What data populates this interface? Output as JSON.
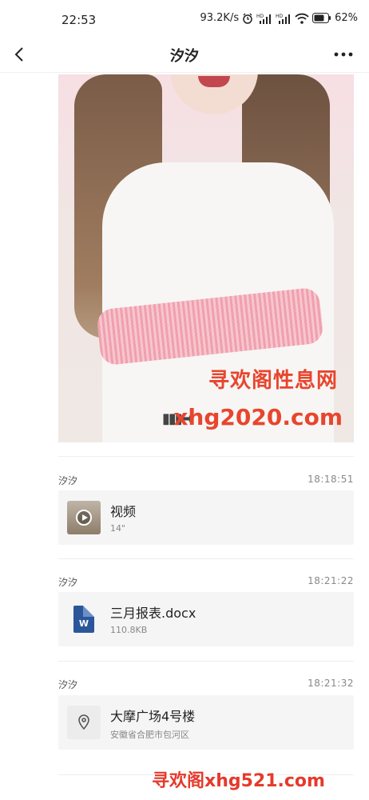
{
  "status_bar": {
    "time": "22:53",
    "speed": "93.2K/s",
    "battery": "62%"
  },
  "header": {
    "title": "汐汐"
  },
  "photo": {
    "watermark_cn": "寻欢阁性息网",
    "watermark_url": "xhg2020.com"
  },
  "messages": [
    {
      "sender": "汐汐",
      "time": "18:18:51",
      "title": "视频",
      "subtitle": "14\"",
      "type": "video"
    },
    {
      "sender": "汐汐",
      "time": "18:21:22",
      "title": "三月报表.docx",
      "subtitle": "110.8KB",
      "type": "document",
      "icon_letter": "W"
    },
    {
      "sender": "汐汐",
      "time": "18:21:32",
      "title": "大摩广场4号楼",
      "subtitle": "安徽省合肥市包河区",
      "type": "location"
    }
  ],
  "footer": {
    "watermark": "寻欢阁xhg521.com"
  },
  "colors": {
    "accent_red": "#e53a2c",
    "word_blue": "#2b579a",
    "card_bg": "#f5f5f5"
  }
}
